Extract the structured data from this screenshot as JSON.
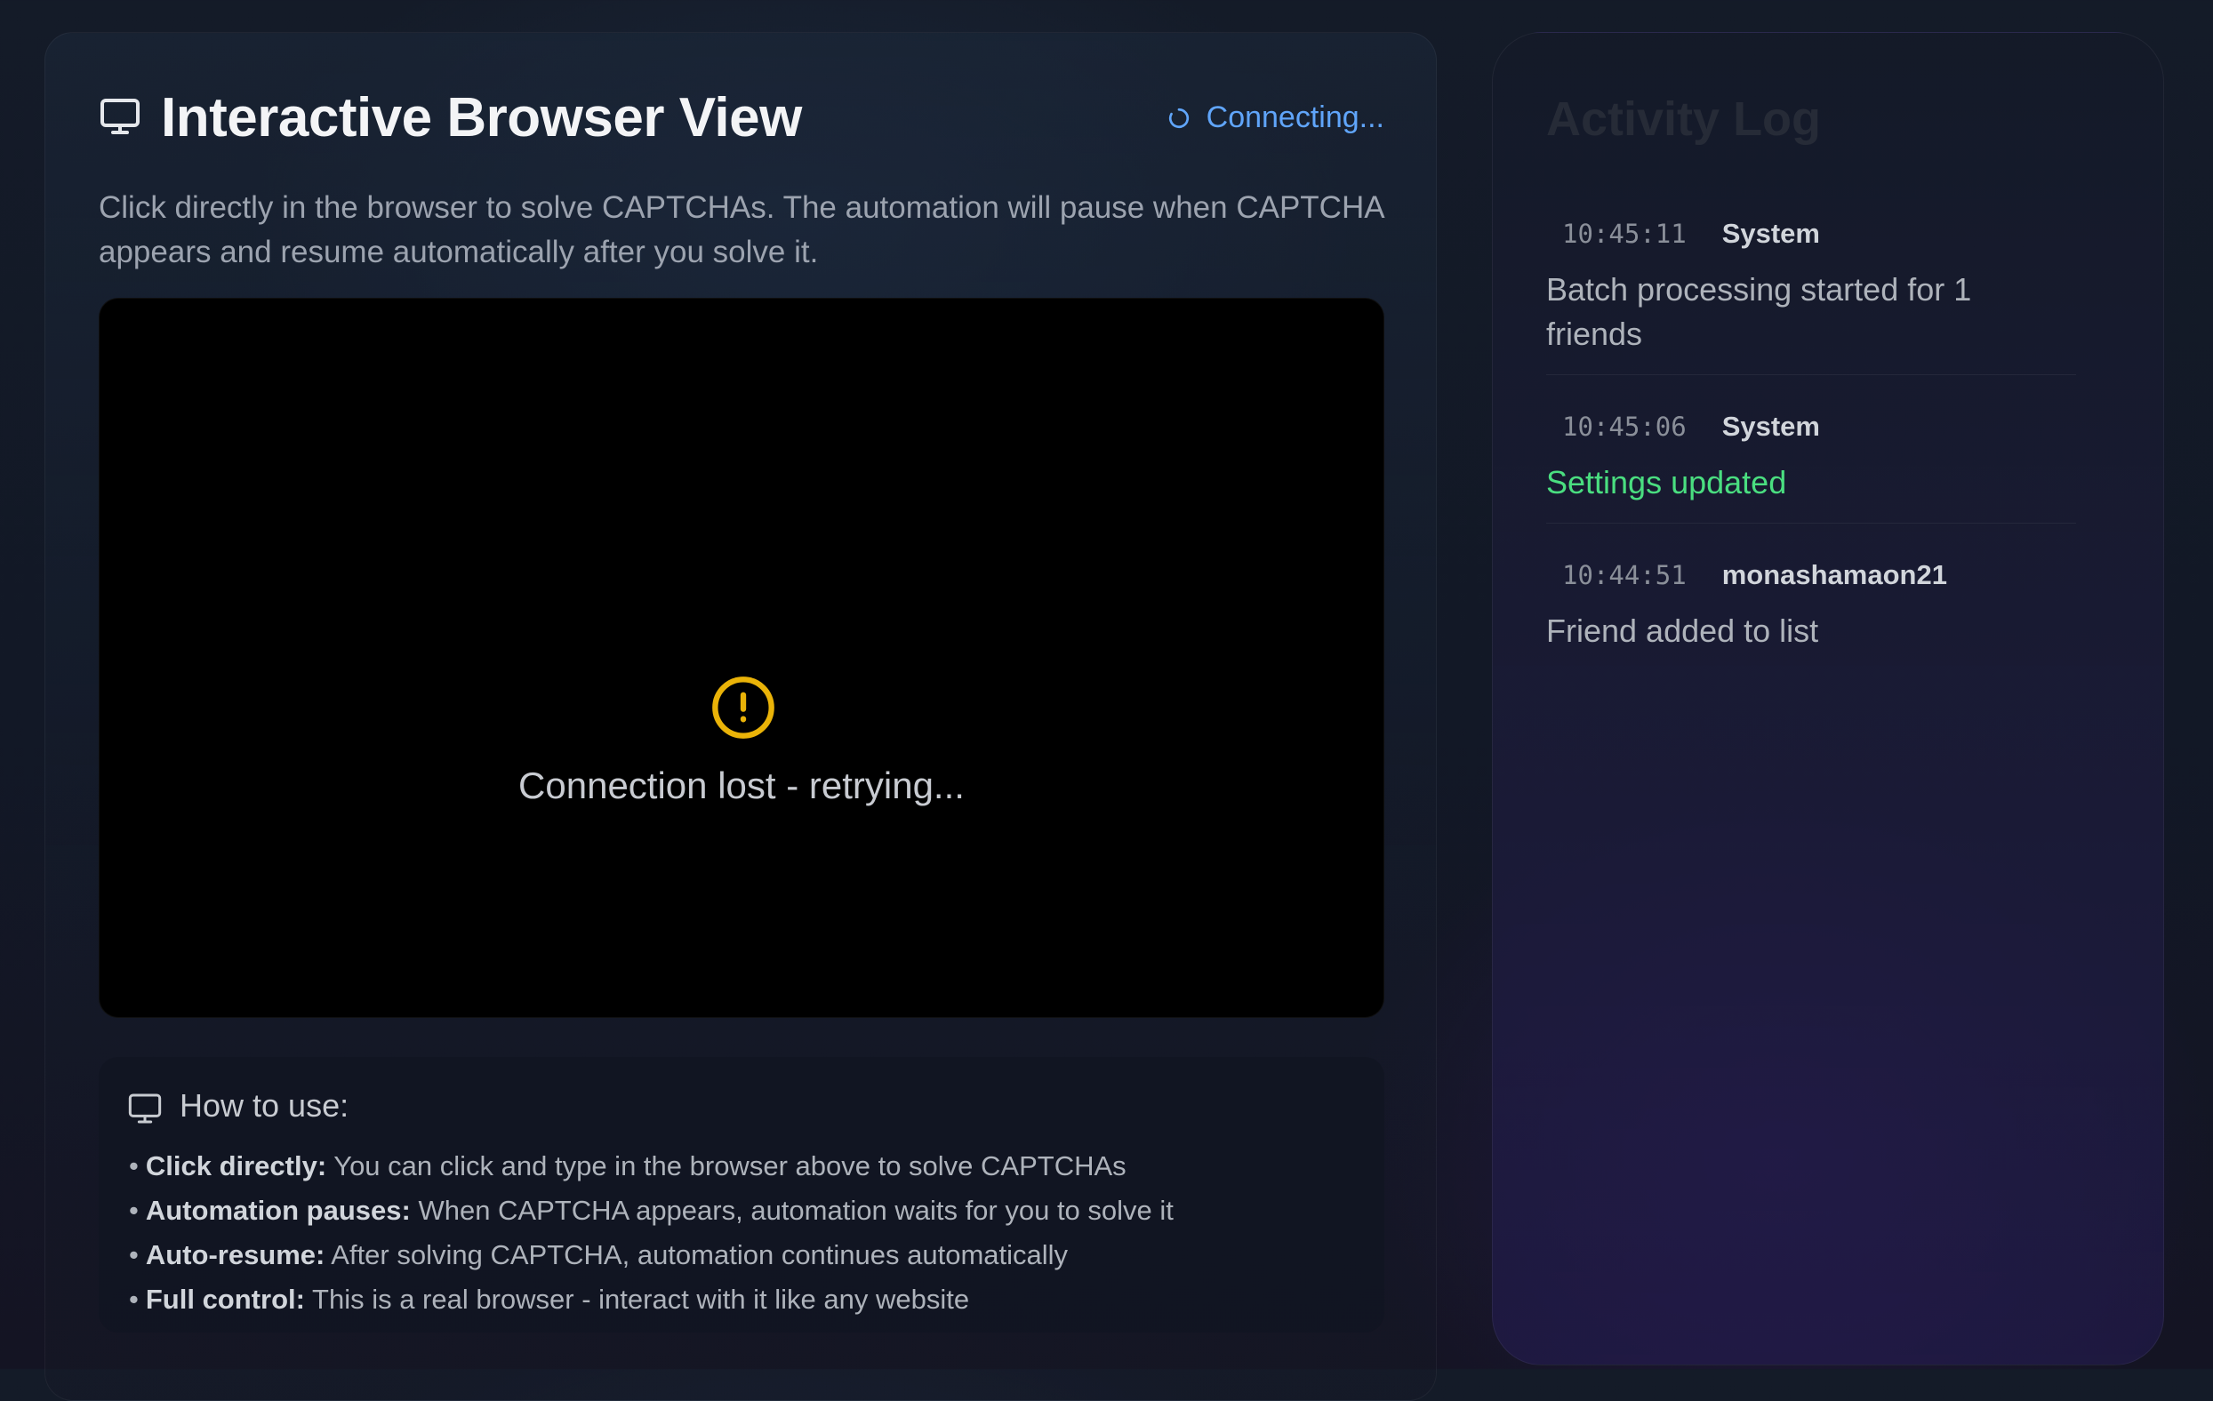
{
  "main": {
    "title": "Interactive Browser View",
    "title_icon": "monitor-icon",
    "status": {
      "label": "Connecting...",
      "icon": "spinner-icon",
      "color": "#60a5fa"
    },
    "subtitle": "Click directly in the browser to solve CAPTCHAs. The automation will pause when CAPTCHA appears and resume automatically after you solve it.",
    "browser": {
      "icon": "warning-circle-icon",
      "icon_color": "#eab308",
      "message": "Connection lost - retrying..."
    },
    "howto": {
      "icon": "monitor-icon",
      "title": "How to use:",
      "items": [
        {
          "label": "Click directly:",
          "text": "You can click and type in the browser above to solve CAPTCHAs"
        },
        {
          "label": "Automation pauses:",
          "text": "When CAPTCHA appears, automation waits for you to solve it"
        },
        {
          "label": "Auto-resume:",
          "text": "After solving CAPTCHA, automation continues automatically"
        },
        {
          "label": "Full control:",
          "text": "This is a real browser - interact with it like any website"
        }
      ]
    }
  },
  "activity_log": {
    "title": "Activity Log",
    "entries": [
      {
        "time": "10:45:11",
        "source": "System",
        "message": "Batch processing started for 1 friends",
        "status": "info"
      },
      {
        "time": "10:45:06",
        "source": "System",
        "message": "Settings updated",
        "status": "success",
        "color": "#4ade80"
      },
      {
        "time": "10:44:51",
        "source": "monashamaon21",
        "message": "Friend added to list",
        "status": "info"
      }
    ]
  }
}
